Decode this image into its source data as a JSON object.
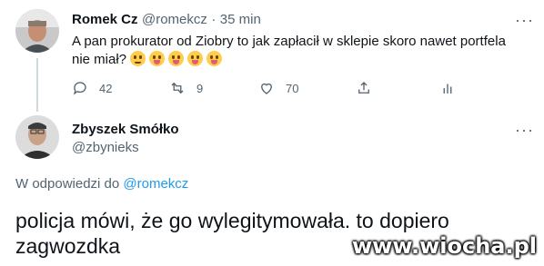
{
  "parent_tweet": {
    "author_name": "Romek Cz",
    "handle": "@romekcz",
    "separator": "·",
    "time": "35 min",
    "text": "A pan prokurator od Ziobry to jak zapłacił w sklepie skoro nawet portfela nie miał?",
    "emoji": [
      "thinking-face",
      "zany-face",
      "zany-face",
      "zany-face",
      "zany-face"
    ],
    "actions": {
      "reply_count": "42",
      "retweet_count": "9",
      "like_count": "70",
      "share_icon": "share-icon",
      "analytics_icon": "analytics-icon"
    },
    "more_label": "···"
  },
  "reply_tweet": {
    "author_name": "Zbyszek Smółko",
    "handle": "@zbynieks",
    "reply_prefix": "W odpowiedzi do",
    "reply_to_handle": "@romekcz",
    "text": "policja mówi, że go wylegitymowała. to dopiero zagwozdka",
    "more_label": "···"
  },
  "watermark": "www.wiocha.pl",
  "colors": {
    "accent": "#1d9bf0",
    "secondary_text": "#536471",
    "thread_line": "#cfd9de"
  }
}
